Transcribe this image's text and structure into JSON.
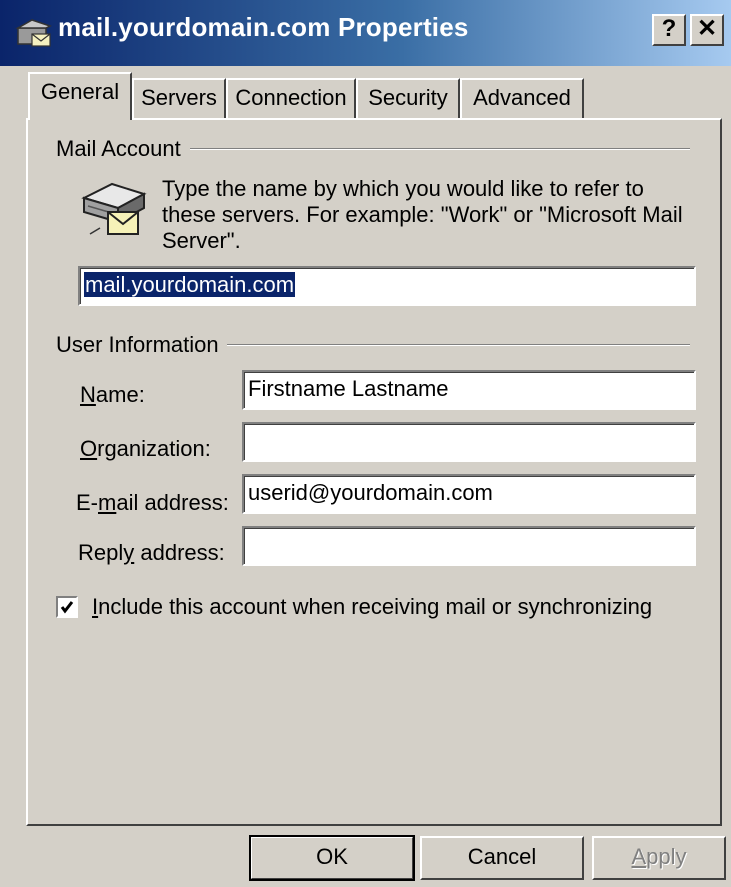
{
  "window": {
    "title": "mail.yourdomain.com Properties",
    "help_button": "?",
    "close_button": "✕"
  },
  "tabs": [
    {
      "label": "General",
      "active": true
    },
    {
      "label": "Servers",
      "active": false
    },
    {
      "label": "Connection",
      "active": false
    },
    {
      "label": "Security",
      "active": false
    },
    {
      "label": "Advanced",
      "active": false
    }
  ],
  "mail_account": {
    "group_label": "Mail Account",
    "help_text": "Type the name by which you would like to refer to these servers.  For example: \"Work\" or \"Microsoft Mail Server\".",
    "account_name": "mail.yourdomain.com"
  },
  "user_information": {
    "group_label": "User Information",
    "name": {
      "label_pre": "",
      "label_key": "N",
      "label_post": "ame:",
      "value": "Firstname Lastname"
    },
    "organization": {
      "label_pre": "",
      "label_key": "O",
      "label_post": "rganization:",
      "value": ""
    },
    "email": {
      "label_pre": "E-",
      "label_key": "m",
      "label_post": "ail address:",
      "value": "userid@yourdomain.com"
    },
    "reply": {
      "label_pre": "Repl",
      "label_key": "y",
      "label_post": " address:",
      "value": ""
    }
  },
  "include_account": {
    "checked": true,
    "label_key": "I",
    "label_post": "nclude this account when receiving mail or synchronizing"
  },
  "buttons": {
    "ok": "OK",
    "cancel": "Cancel",
    "apply_key": "A",
    "apply_post": "pply"
  },
  "colors": {
    "title_start": "#0a246a",
    "title_end": "#a6caf0",
    "face": "#d4d0c8",
    "selection": "#0a246a"
  }
}
